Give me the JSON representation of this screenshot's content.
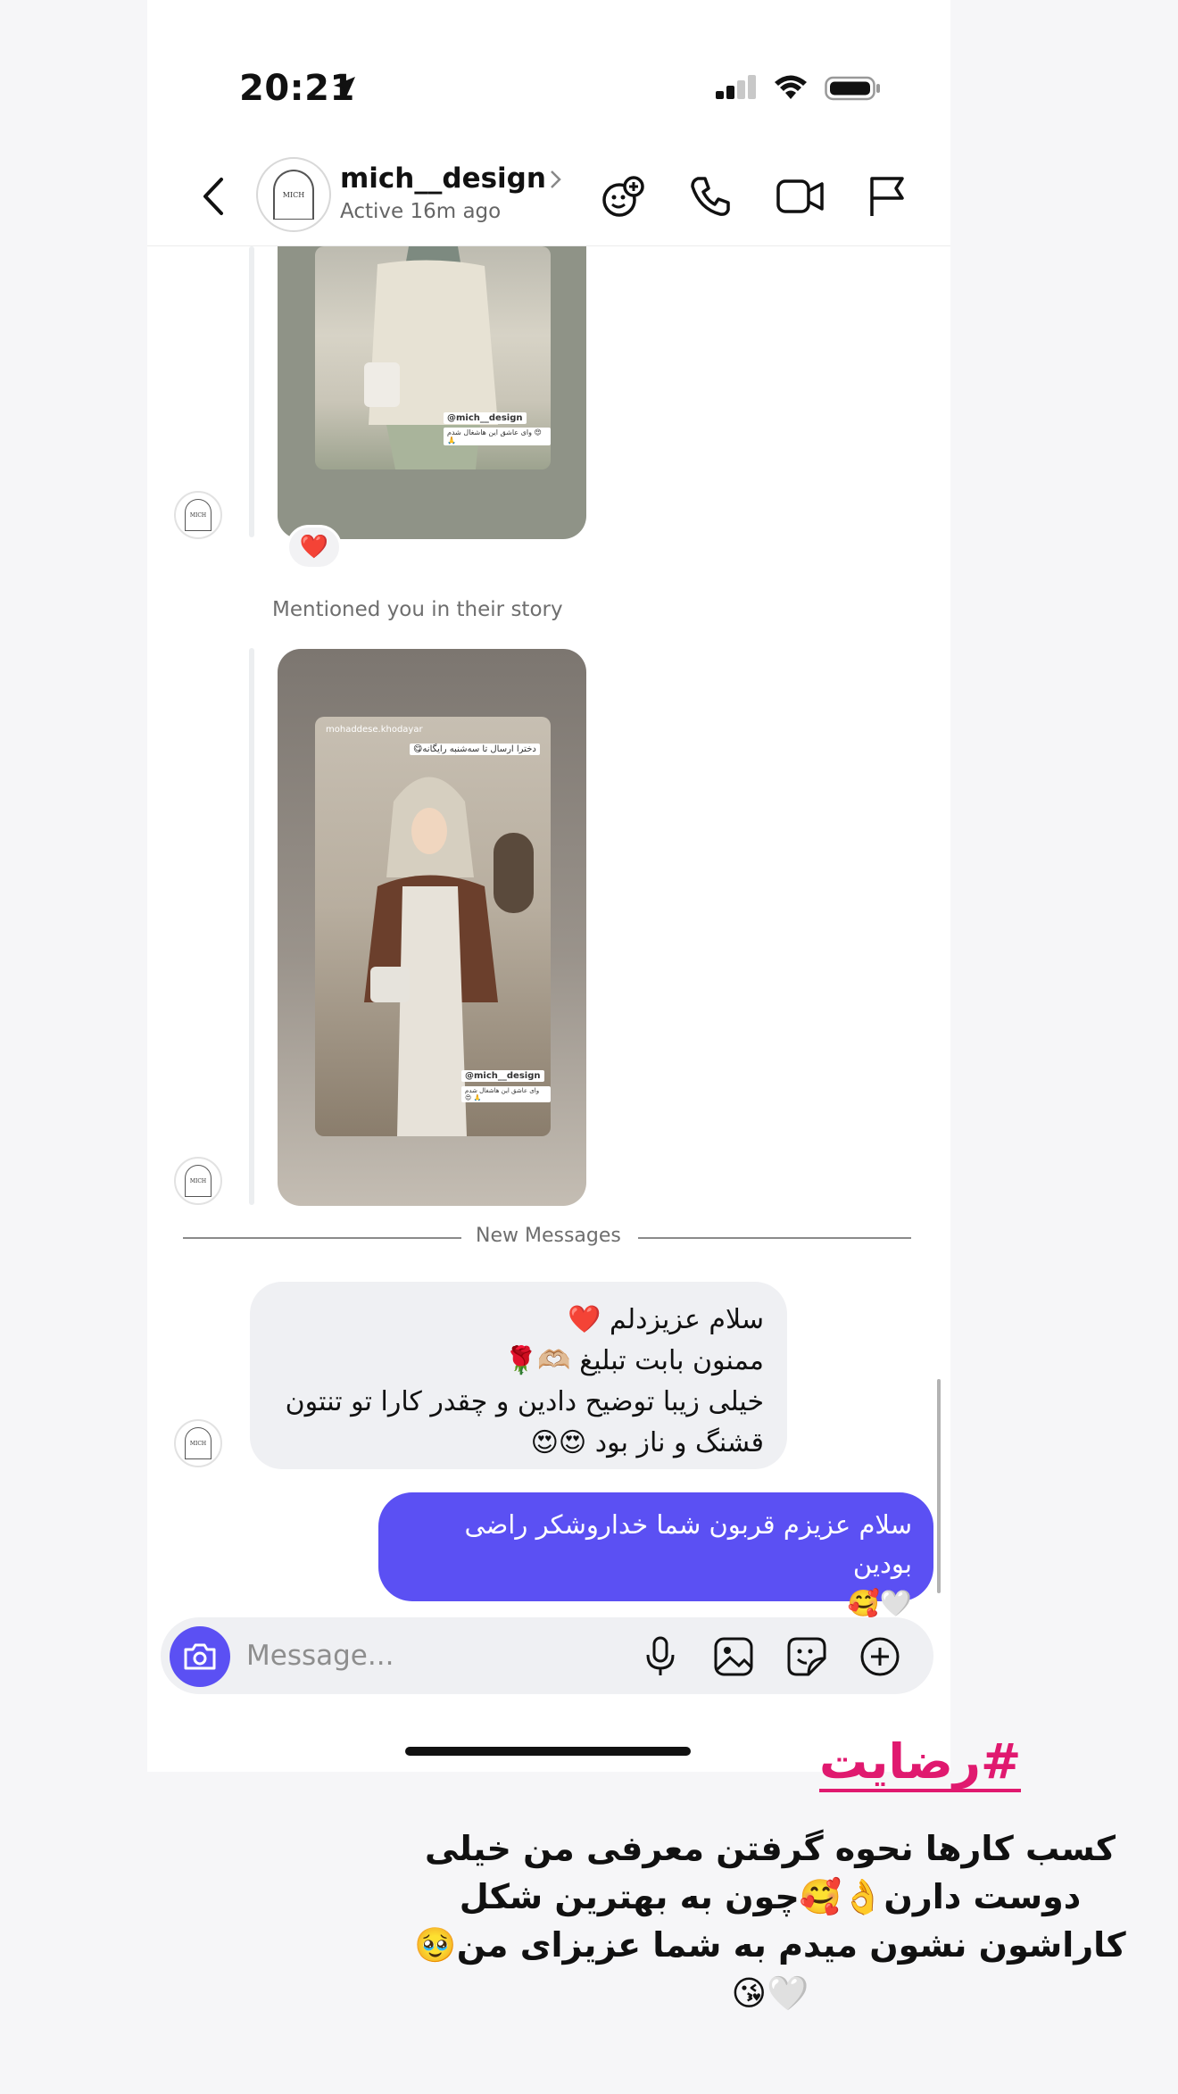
{
  "status_bar": {
    "time": "20:21"
  },
  "header": {
    "username": "mich__design",
    "active_status": "Active 16m ago",
    "avatar_brand": "MICH"
  },
  "stories": [
    {
      "reaction": "❤️",
      "handle_tag": "@mich__design",
      "caption_strip": "وای عاشق این هاشغال شدم 😍 🙏"
    },
    {
      "mention_text": "Mentioned you in their story",
      "author": "mohaddese.khodayar",
      "sticker_text": "دخترا ارسال تا سه‌شنبه رایگانه😋",
      "handle_tag": "@mich__design",
      "caption_strip": "وای عاشق این هاشغال شدم 😍 🙏"
    }
  ],
  "divider_label": "New Messages",
  "messages": {
    "incoming": [
      "سلام عزیزدلم ❤️",
      "ممنون بابت تبلیغ 🫶🏼🌹",
      "خیلی زیبا توضیح دادین و چقدر کارا تو تنتون",
      "قشنگ و ناز بود 😍😍"
    ],
    "outgoing": [
      "سلام عزیزم قربون شما خداروشکر راضی بودین",
      "🤍🥰"
    ]
  },
  "composer": {
    "placeholder": "Message..."
  },
  "overlay": {
    "hashtag": "#رضایت",
    "caption_lines": [
      "کسب کارها نحوه گرفتن معرفی من خیلی",
      "دوست دارن👌🥰چون به بهترین شکل",
      "کاراشون نشون میدم به شما عزیزای من🥹",
      "🤍😘"
    ]
  },
  "colors": {
    "accent": "#5b50f3",
    "incoming_bubble": "#eff0f3",
    "hashtag": "#e0196f"
  },
  "icons": [
    "location-arrow-icon",
    "signal-icon",
    "wifi-icon",
    "battery-icon",
    "back-icon",
    "chevron-right-icon",
    "effects-icon",
    "phone-icon",
    "video-icon",
    "flag-icon",
    "camera-icon",
    "mic-icon",
    "gallery-icon",
    "sticker-icon",
    "add-icon"
  ]
}
